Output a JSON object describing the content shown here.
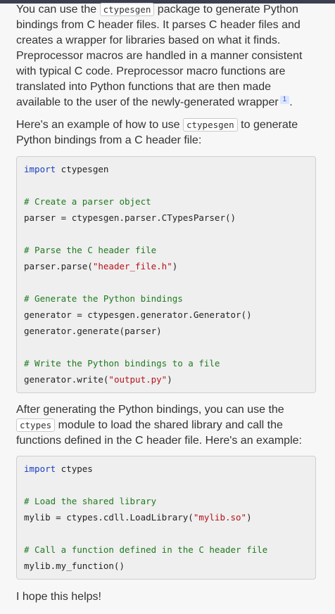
{
  "para1": {
    "text1": "You can use the ",
    "code": "ctypesgen",
    "text2": " package to generate Python bindings from C header files. It parses C header files and creates a wrapper for libraries based on what it finds. Preprocessor macros are handled in a manner consistent with typical C code. Preprocessor macro functions are translated into Python functions that are then made available to the user of the newly-generated wrapper",
    "citation": "1",
    "end": "."
  },
  "para2": {
    "text1": "Here's an example of how to use ",
    "code": "ctypesgen",
    "text2": " to generate Python bindings from a C header file:"
  },
  "code1": {
    "l1_kw": "import",
    "l1_rest": " ctypesgen",
    "l3": "# Create a parser object",
    "l4": "parser = ctypesgen.parser.CTypesParser()",
    "l6": "# Parse the C header file",
    "l7_a": "parser.parse(",
    "l7_str": "\"header_file.h\"",
    "l7_b": ")",
    "l9": "# Generate the Python bindings",
    "l10": "generator = ctypesgen.generator.Generator()",
    "l11": "generator.generate(parser)",
    "l13": "# Write the Python bindings to a file",
    "l14_a": "generator.write(",
    "l14_str": "\"output.py\"",
    "l14_b": ")"
  },
  "para3": {
    "text1": "After generating the Python bindings, you can use the ",
    "code": "ctypes",
    "text2": " module to load the shared library and call the functions defined in the C header file. Here's an example:"
  },
  "code2": {
    "l1_kw": "import",
    "l1_rest": " ctypes",
    "l3": "# Load the shared library",
    "l4_a": "mylib = ctypes.cdll.LoadLibrary(",
    "l4_str": "\"mylib.so\"",
    "l4_b": ")",
    "l6": "# Call a function defined in the C header file",
    "l7": "mylib.my_function()"
  },
  "para4": {
    "text": "I hope this helps!"
  }
}
